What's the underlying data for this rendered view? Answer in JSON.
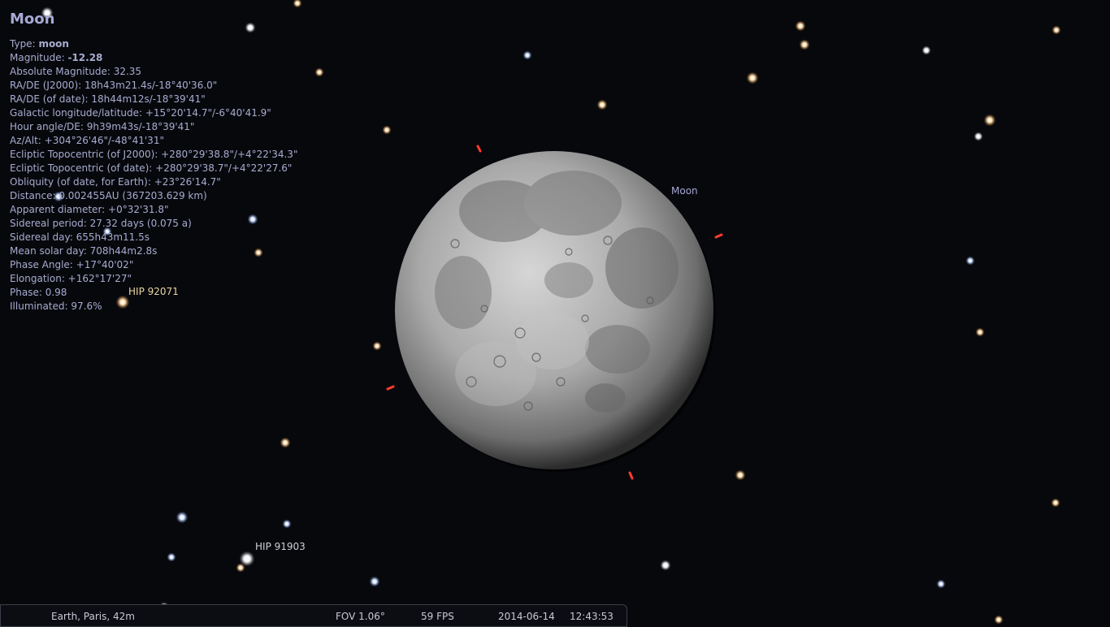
{
  "object_info": {
    "name": "Moon",
    "type_label": "Type:",
    "type_value": "moon",
    "magnitude_label": "Magnitude:",
    "magnitude_value": "-12.28",
    "rows": [
      "Absolute Magnitude: 32.35",
      "RA/DE (J2000): 18h43m21.4s/-18°40'36.0\"",
      "RA/DE (of date): 18h44m12s/-18°39'41\"",
      "Galactic longitude/latitude: +15°20'14.7\"/-6°40'41.9\"",
      "Hour angle/DE: 9h39m43s/-18°39'41\"",
      "Az/Alt: +304°26'46\"/-48°41'31\"",
      "Ecliptic Topocentric (of J2000): +280°29'38.8\"/+4°22'34.3\"",
      "Ecliptic Topocentric (of date): +280°29'38.7\"/+4°22'27.6\"",
      "Obliquity (of date, for Earth): +23°26'14.7\"",
      "Distance: 0.002455AU (367203.629 km)",
      "Apparent diameter: +0°32'31.8\"",
      "Sidereal period: 27.32 days (0.075 a)",
      "Sidereal day: 655h43m11.5s",
      "Mean solar day: 708h44m2.8s",
      "Phase Angle: +17°40'02\"",
      "Elongation: +162°17'27\"",
      "Phase: 0.98",
      "Illuminated: 97.6%"
    ]
  },
  "sky_labels": {
    "moon": "Moon",
    "star_a": "HIP 92071",
    "star_b": "HIP 91903"
  },
  "status_bar": {
    "location": "Earth, Paris, 42m",
    "fov": "FOV 1.06°",
    "fps": "59 FPS",
    "date": "2014-06-14",
    "time": "12:43:53"
  },
  "colors": {
    "info_text": "#a8acd0",
    "star_label_warm": "#e8d6a0",
    "star_label_neutral": "#cfd0d8",
    "moon_label": "#a6a9d4",
    "pointer": "#ff3b2f"
  }
}
